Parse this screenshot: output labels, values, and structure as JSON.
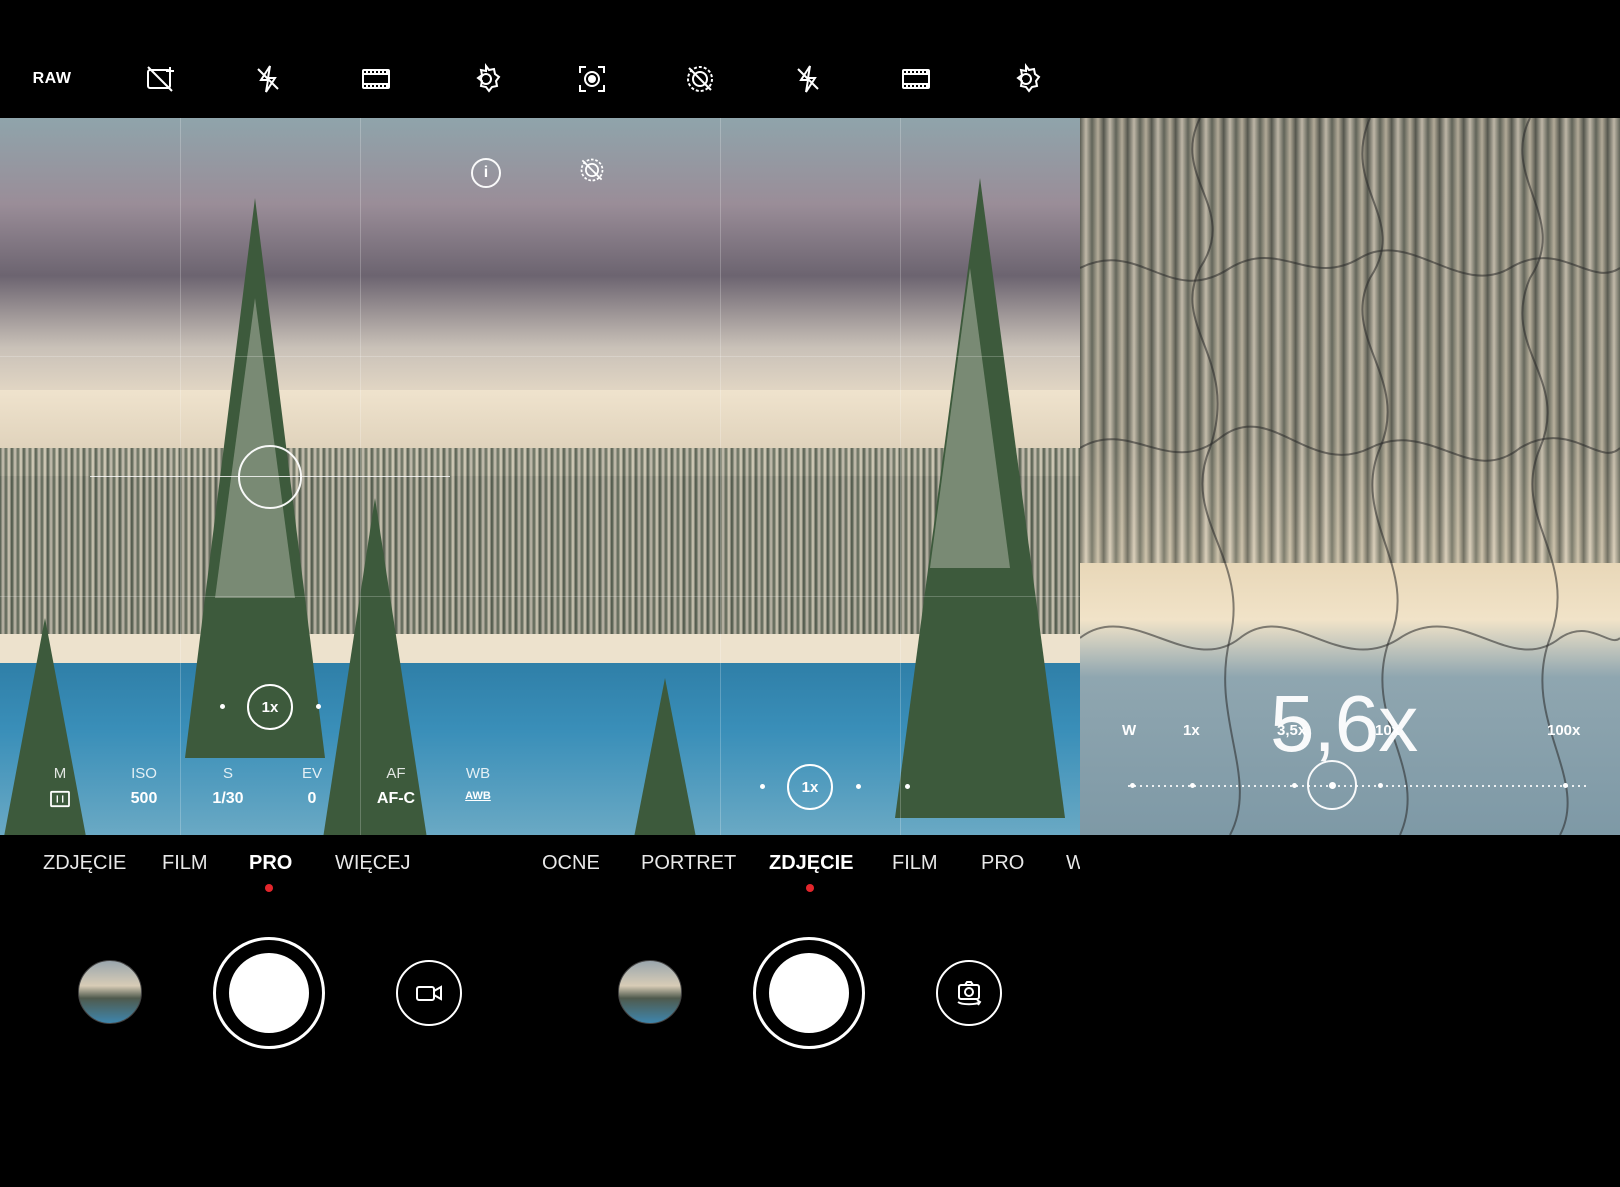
{
  "pro_panel": {
    "top_bar": {
      "raw": "RAW"
    },
    "zoom": "1x",
    "params": [
      {
        "label": "M",
        "value": ""
      },
      {
        "label": "ISO",
        "value": "500"
      },
      {
        "label": "S",
        "value": "1/30"
      },
      {
        "label": "EV",
        "value": "0"
      },
      {
        "label": "AF",
        "value": "AF-C"
      },
      {
        "label": "WB",
        "value": "AWB"
      }
    ],
    "modes": [
      "ZDJĘCIE",
      "FILM",
      "PRO",
      "WIĘCEJ"
    ],
    "active_mode": "PRO"
  },
  "photo_panel": {
    "zoom": "1x",
    "modes": [
      "OCNE",
      "PORTRET",
      "ZDJĘCIE",
      "FILM",
      "PRO",
      "W"
    ],
    "active_mode": "ZDJĘCIE"
  },
  "zoom_panel": {
    "zoom_level": "5,6x",
    "scale_labels": [
      "W",
      "1x",
      "3,5x",
      "10x",
      "100x"
    ]
  },
  "colors": {
    "background": "#000000",
    "active_dot": "#e3262c",
    "text": "#ffffff"
  },
  "icons": [
    "raw-icon",
    "ai-off-icon",
    "flash-off-icon",
    "aspect-ratio-icon",
    "gear-icon",
    "scene-icon",
    "live-photo-off-icon",
    "video-icon",
    "switch-camera-icon",
    "info-icon"
  ]
}
